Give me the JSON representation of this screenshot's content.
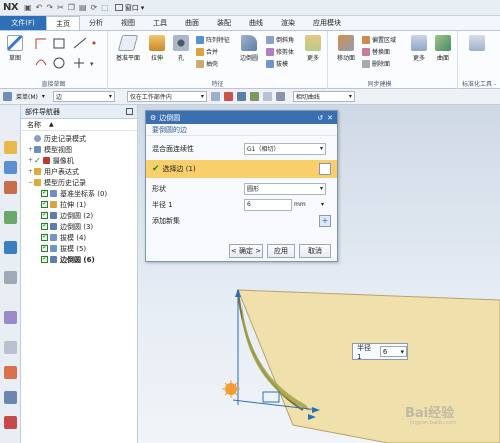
{
  "app": {
    "logo": "NX",
    "window_label": "窗口"
  },
  "menu": {
    "file_label": "文件(F)",
    "tabs": [
      "主页",
      "分析",
      "视图",
      "工具",
      "曲面",
      "装配",
      "曲线",
      "渲染",
      "应用模块"
    ]
  },
  "ribbon": {
    "sketch": "草图",
    "direct_sketch_group": "直接草图",
    "datum_plane": "基准平面",
    "extrude": "拉伸",
    "hole": "孔",
    "array_feature": "阵列特征",
    "combine": "合并",
    "shell": "抽壳",
    "edge_blend": "边倒圆",
    "chamfer": "倒斜角",
    "trim_body": "修剪体",
    "draft": "拔模",
    "more1": "更多",
    "feature_group": "特征",
    "move_face": "移动面",
    "offset_region": "偏置区域",
    "replace_face": "替换面",
    "delete_face": "删除面",
    "more2": "更多",
    "sync_group": "同步建模",
    "surface": "曲面",
    "standard_tools": "标准化工具 -"
  },
  "toolbar": {
    "menu_label": "菜单(M)",
    "filter_value": "边",
    "scope_value": "仅在工作部件内",
    "curve_rule": "相切曲线"
  },
  "navigator": {
    "title": "部件导航器",
    "col_name": "名称",
    "items": [
      "历史记录模式",
      "模型视图",
      "摄像机",
      "用户表达式",
      "模型历史记录",
      "基准坐标系 (0)",
      "拉伸 (1)",
      "边倒圆 (2)",
      "边倒圆 (3)",
      "拔模 (4)",
      "拔模 (5)",
      "边倒圆 (6)"
    ]
  },
  "dialog": {
    "title": "边倒圆",
    "section": "要倒圆的边",
    "continuity_label": "混合面连续性",
    "continuity_value": "G1（相切）",
    "select_edge": "选择边 (1)",
    "shape_label": "形状",
    "shape_value": "圆形",
    "radius_label": "半径 1",
    "radius_value": "6",
    "radius_unit": "mm",
    "add_set": "添加新集",
    "ok": "< 确定 >",
    "apply": "应用",
    "cancel": "取消"
  },
  "onscreen": {
    "label": "半径 1",
    "value": "6"
  },
  "watermark": {
    "text": "Bai经验",
    "sub": "jingyan.baidu.com"
  },
  "colors": {
    "accent": "#2f6fb8",
    "selected_row": "#f9cf6b",
    "part": "#f0e1ac"
  }
}
